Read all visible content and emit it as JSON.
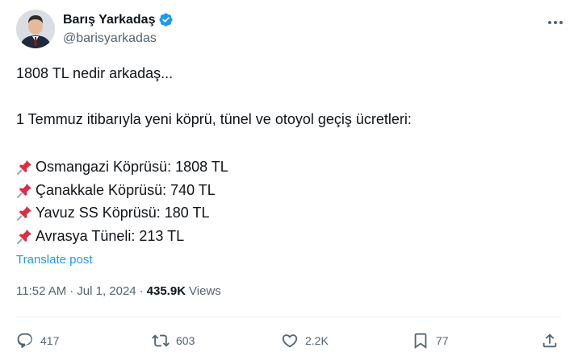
{
  "author": {
    "name": "Barış Yarkadaş",
    "handle": "@barisyarkadas",
    "verified": true,
    "verified_icon": "verified-badge-icon",
    "verified_color": "#1d9bf0"
  },
  "tweet": {
    "line1": "1808 TL nedir arkadaş...",
    "line2": "1 Temmuz itibarıyla yeni köprü, tünel ve otoyol geçiş ücretleri:",
    "items": [
      "Osmangazi Köprüsü: 1808 TL",
      "Çanakkale Köprüsü: 740 TL",
      "Yavuz SS Köprüsü: 180 TL",
      "Avrasya Tüneli: 213 TL"
    ],
    "item_icon": "pushpin-icon"
  },
  "translate_label": "Translate post",
  "meta": {
    "time": "11:52 AM",
    "separator": "·",
    "date": "Jul 1, 2024",
    "views_count": "435.9K",
    "views_label": "Views"
  },
  "actions": {
    "replies": "417",
    "reposts": "603",
    "likes": "2.2K",
    "bookmarks": "77"
  },
  "colors": {
    "text": "#0f1419",
    "secondary": "#536471",
    "link": "#1d9bf0"
  }
}
